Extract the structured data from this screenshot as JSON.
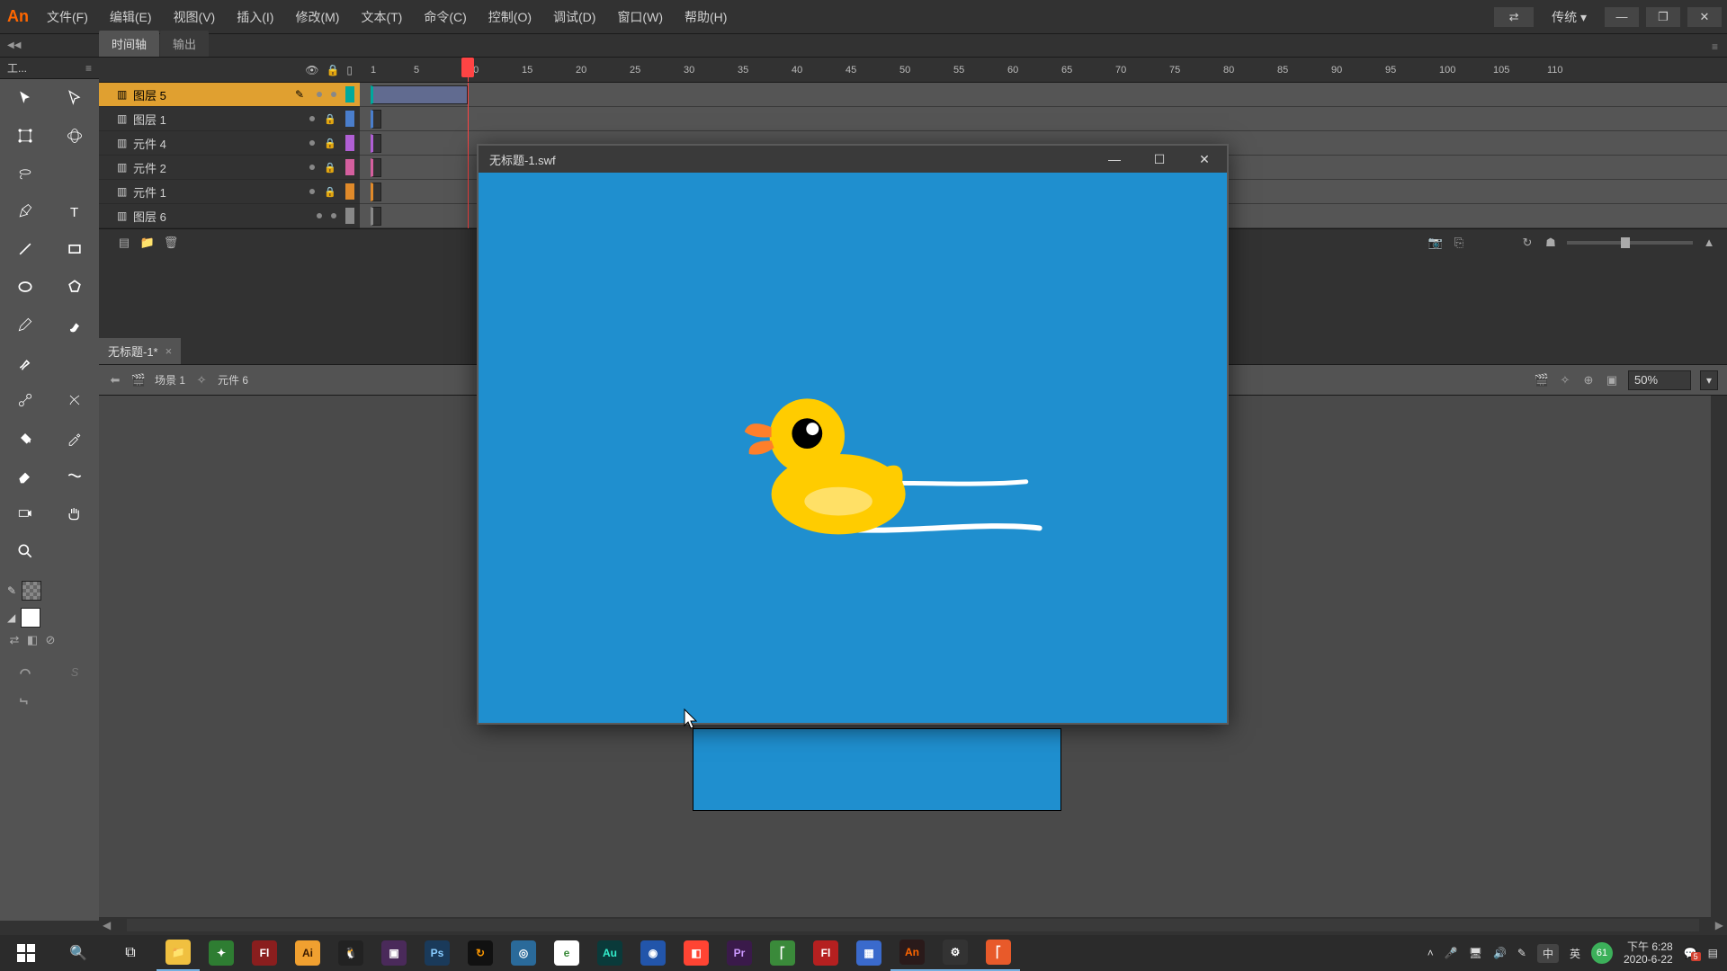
{
  "app": {
    "logo": "An"
  },
  "menu": {
    "file": "文件(F)",
    "edit": "编辑(E)",
    "view": "视图(V)",
    "insert": "插入(I)",
    "modify": "修改(M)",
    "text": "文本(T)",
    "commands": "命令(C)",
    "control": "控制(O)",
    "debug": "调试(D)",
    "window": "窗口(W)",
    "help": "帮助(H)"
  },
  "workspace": {
    "label": "传统"
  },
  "tools": {
    "header": "工..."
  },
  "timeline": {
    "tab_timeline": "时间轴",
    "tab_output": "输出",
    "frames": [
      1,
      5,
      10,
      15,
      20,
      25,
      30,
      35,
      40,
      45,
      50,
      55,
      60,
      65,
      70,
      75,
      80,
      85,
      90,
      95,
      100,
      105,
      110
    ],
    "playhead_frame": 10,
    "layers": [
      {
        "name": "图层 5",
        "selected": true,
        "locked": false,
        "color": "#00a99d"
      },
      {
        "name": "图层 1",
        "selected": false,
        "locked": true,
        "color": "#4a7ecc"
      },
      {
        "name": "元件 4",
        "selected": false,
        "locked": true,
        "color": "#b05fd4"
      },
      {
        "name": "元件 2",
        "selected": false,
        "locked": true,
        "color": "#d45f9e"
      },
      {
        "name": "元件 1",
        "selected": false,
        "locked": true,
        "color": "#e08a2a"
      },
      {
        "name": "图层 6",
        "selected": false,
        "locked": false,
        "color": "#888888"
      }
    ]
  },
  "document": {
    "tab": "无标题-1*",
    "scene": "场景 1",
    "symbol": "元件 6",
    "zoom": "50%"
  },
  "swf": {
    "title": "无标题-1.swf"
  },
  "taskbar": {
    "ime_locale": "中",
    "ime_lang": "英",
    "accel_num": "61",
    "time": "下午 6:28",
    "date": "2020-6-22",
    "notif_count": "5"
  }
}
